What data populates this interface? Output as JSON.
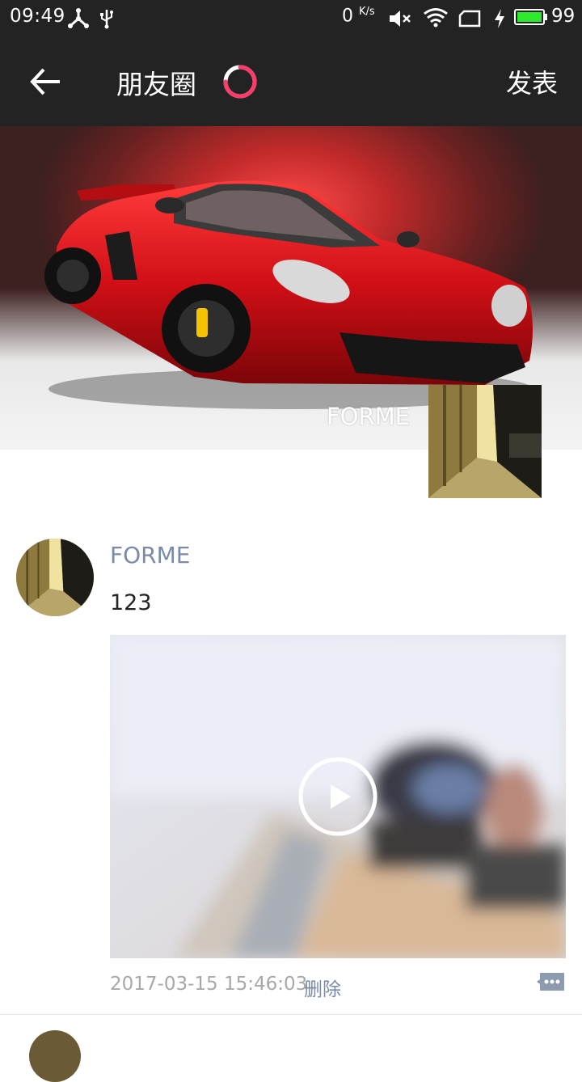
{
  "status_bar": {
    "time": "09:49",
    "network_speed": "0",
    "network_unit": "K/s",
    "battery_level": "99",
    "battery_color": "#2ee82e",
    "icons": [
      "share-node-icon",
      "usb-icon",
      "mute-icon",
      "wifi-icon",
      "sim-card-icon",
      "charging-icon",
      "battery-icon"
    ]
  },
  "header": {
    "title": "朋友圈",
    "publish_label": "发表",
    "background": "#232323"
  },
  "cover": {
    "user_name": "FORME"
  },
  "posts": [
    {
      "user_name": "FORME",
      "text": "123",
      "timestamp": "2017-03-15 15:46:03",
      "delete_label": "删除",
      "media_type": "video"
    }
  ],
  "colors": {
    "link": "#7a8aa8",
    "timestamp": "#a8a8a8",
    "loader_accent": "#ff3b6a"
  }
}
